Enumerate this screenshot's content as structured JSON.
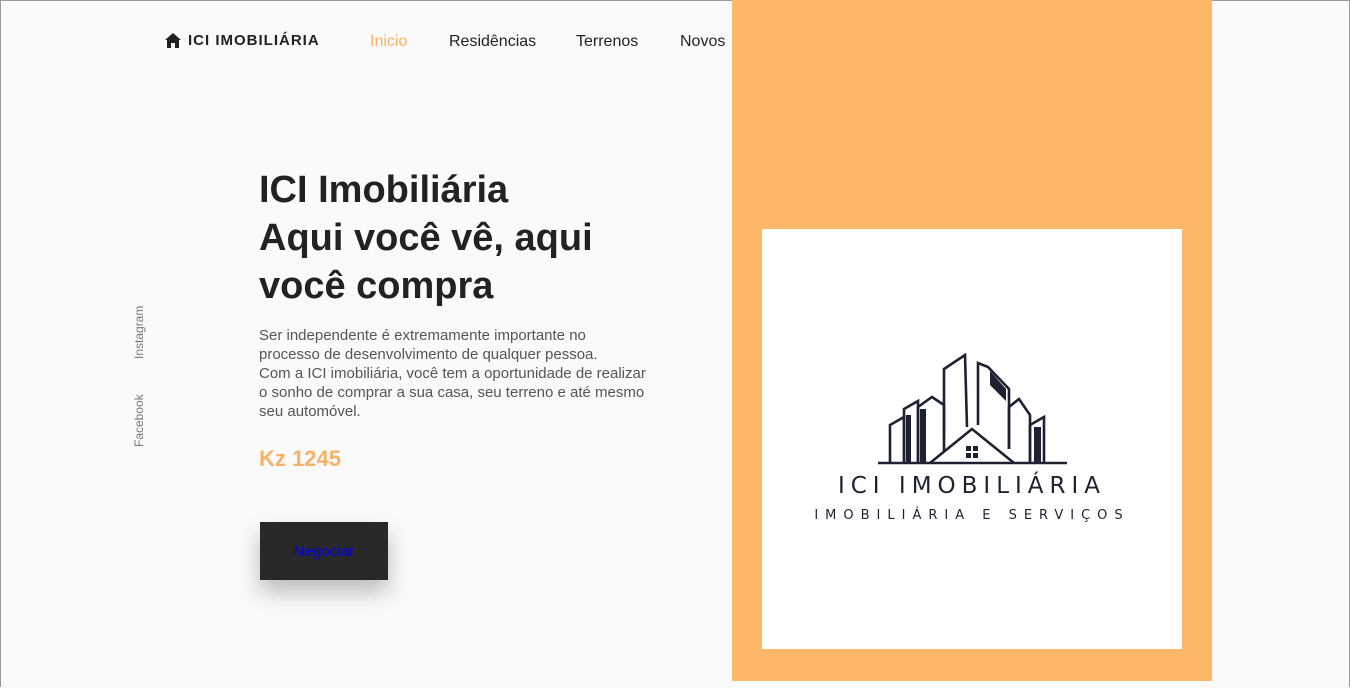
{
  "brand": {
    "name": "ICI IMOBILIÁRIA",
    "icon": "home-icon"
  },
  "nav": {
    "items": [
      {
        "label": "Inicio",
        "active": true
      },
      {
        "label": "Residências",
        "active": false
      },
      {
        "label": "Terrenos",
        "active": false
      },
      {
        "label": "Novos",
        "active": false
      }
    ],
    "theme_toggle_icon": "moon-icon"
  },
  "social": {
    "instagram": "Instagram",
    "facebook": "Facebook"
  },
  "hero": {
    "title_lines": [
      "ICI Imobiliária",
      "Aqui você vê, aqui",
      "você compra"
    ],
    "description_lines": [
      "Ser independente é extremamente importante no",
      "processo de desenvolvimento de qualquer pessoa.",
      "Com a ICI imobiliária, você tem a oportunidade de realizar",
      "o sonho de comprar a sua casa, seu terreno e até mesmo",
      "seu automóvel."
    ],
    "price": "Kz 1245",
    "cta_label": "Negociar"
  },
  "logo": {
    "name": "ICI IMOBILIÁRIA",
    "subtitle": "IMOBILIÁRIA E SERVIÇOS"
  },
  "colors": {
    "accent": "#f8b267",
    "panel": "#ffb768",
    "button_bg": "#282828",
    "link": "#0000ee",
    "logo_ink": "#1d2233"
  }
}
